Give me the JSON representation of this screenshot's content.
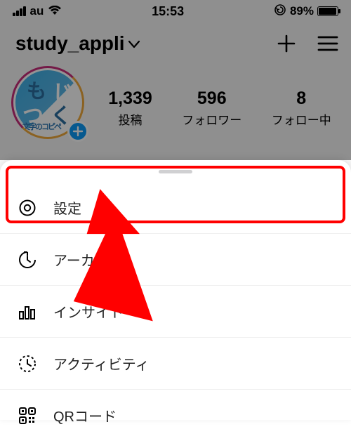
{
  "statusbar": {
    "carrier": "au",
    "time": "15:53",
    "battery_pct": "89%"
  },
  "header": {
    "username": "study_appli"
  },
  "profile": {
    "avatar_line1a": "も",
    "avatar_line1b": "じ",
    "avatar_line2a": "つ",
    "avatar_line2b": "く",
    "avatar_sub": "文字のコピペ"
  },
  "stats": {
    "posts_count": "1,339",
    "posts_label": "投稿",
    "followers_count": "596",
    "followers_label": "フォロワー",
    "following_count": "8",
    "following_label": "フォロー中"
  },
  "menu": {
    "settings": "設定",
    "archive": "アーカイブ",
    "insights": "インサイト",
    "activity": "アクティビティ",
    "qrcode": "QRコード"
  }
}
